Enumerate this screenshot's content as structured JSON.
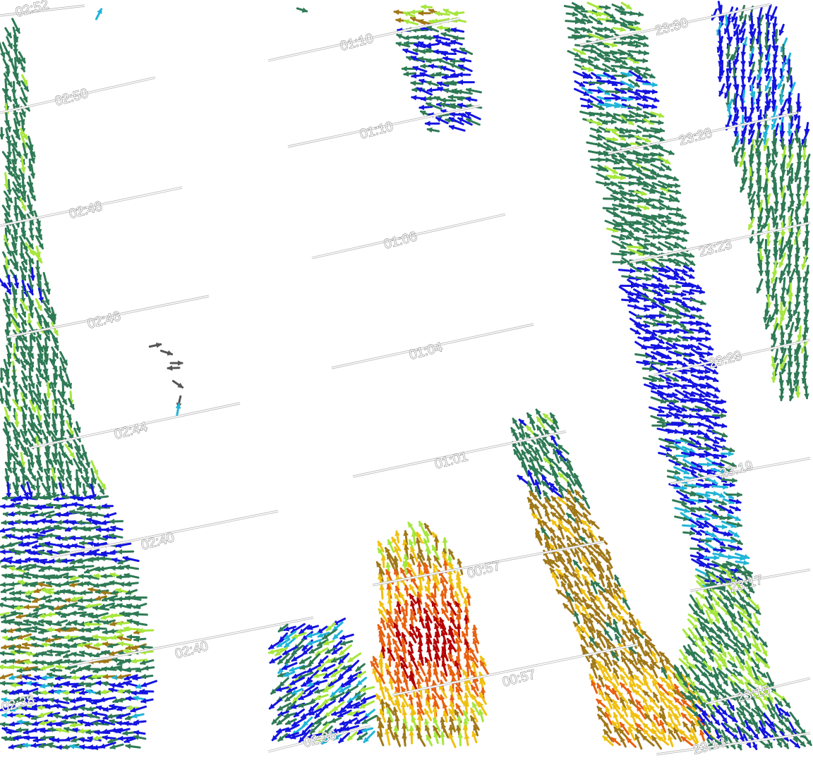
{
  "map": {
    "type": "wind-vector-swaths",
    "colors": {
      "blue": "#1414e0",
      "cyan": "#20b4d8",
      "dark_green": "#2e7a55",
      "lime": "#a6e63c",
      "brown": "#a07818",
      "yellow": "#f0c010",
      "orange": "#e86010",
      "red": "#b40000",
      "gray": "#555555"
    },
    "labels": [
      "02:52",
      "02:50",
      "02:48",
      "02:46",
      "02:44",
      "02:40",
      "02:40",
      "02:38",
      "02:36",
      "01:10",
      "01:10",
      "01:06",
      "01:04",
      "01:01",
      "00:57",
      "00:57",
      "23:30",
      "23:28",
      "23:23",
      "23:23",
      "23:19",
      "23:17",
      "23:15",
      "23:13"
    ]
  }
}
